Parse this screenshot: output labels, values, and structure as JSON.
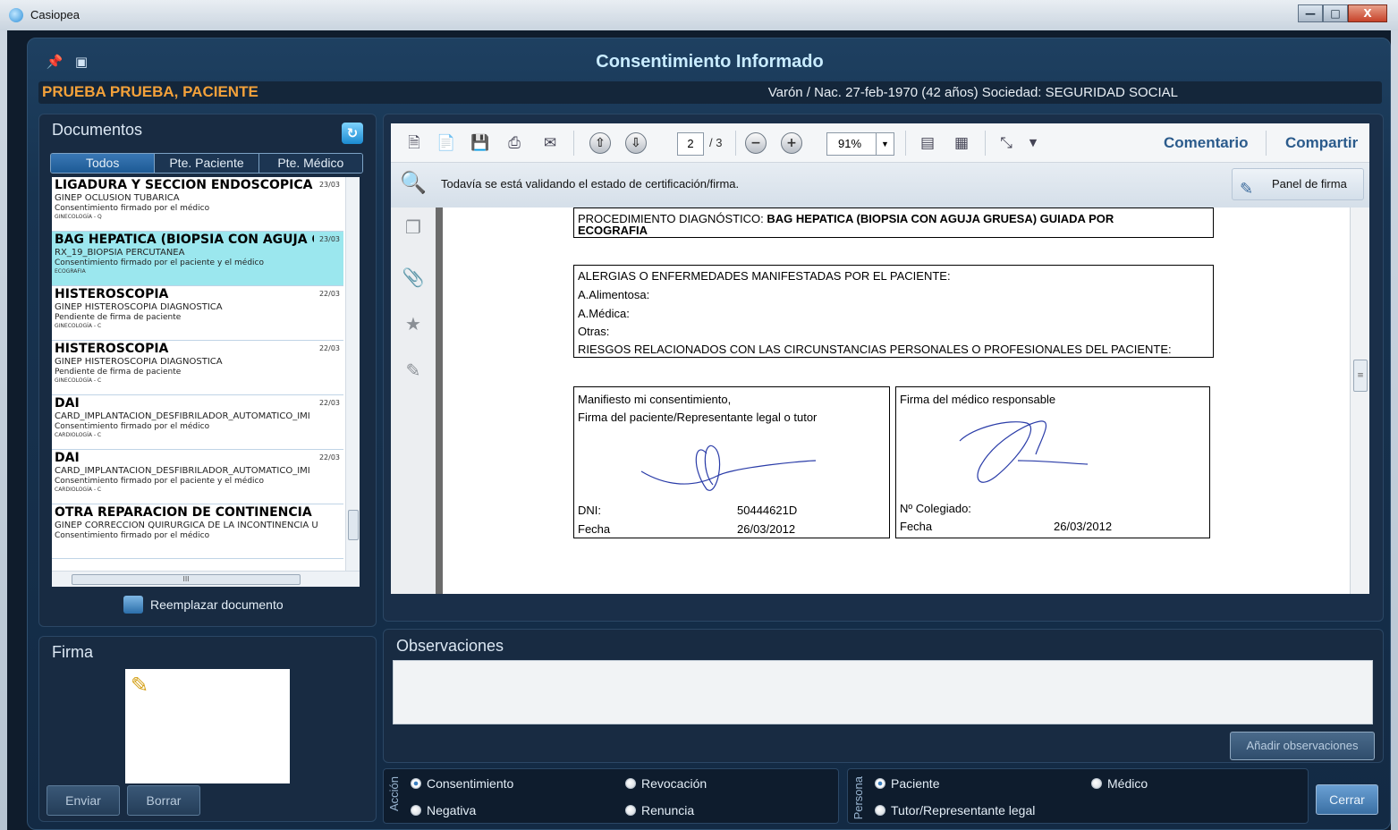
{
  "window": {
    "title": "Casiopea",
    "min": "—",
    "max": "□",
    "close": "X"
  },
  "header": {
    "title": "Consentimiento Informado",
    "patient_name": "PRUEBA PRUEBA, PACIENTE",
    "patient_info": "Varón / Nac. 27-feb-1970 (42 años) Sociedad: SEGURIDAD SOCIAL"
  },
  "docs": {
    "title": "Documentos",
    "tabs": [
      "Todos",
      "Pte. Paciente",
      "Pte. Médico"
    ],
    "items": [
      {
        "title": "LIGADURA Y SECCION ENDOSCOPICA BI...",
        "date": "23/03",
        "sub": "GINEP OCLUSIÓN TUBÁRICA",
        "status": "Consentimiento firmado por el médico",
        "dept": "GINECOLOGÍA - Q"
      },
      {
        "title": "BAG HEPATICA (BIOPSIA CON AGUJA G...",
        "date": "23/03",
        "sub": "RX_19_BIOPSIA PERCUTANEA",
        "status": "Consentimiento firmado por el paciente y el médico",
        "dept": "ECOGRAFIA"
      },
      {
        "title": "HISTEROSCOPIA",
        "date": "22/03",
        "sub": "GINEP HISTEROSCOPIA DIAGNÓSTICA",
        "status": "Pendiente de firma de paciente",
        "dept": "GINECOLOGÍA - C"
      },
      {
        "title": "HISTEROSCOPIA",
        "date": "22/03",
        "sub": "GINEP HISTEROSCOPIA DIAGNÓSTICA",
        "status": "Pendiente de firma de paciente",
        "dept": "GINECOLOGÍA - C"
      },
      {
        "title": "DAI",
        "date": "22/03",
        "sub": "CARD_IMPLANTACION_DESFIBRILADOR_AUTOMATICO_IMI",
        "status": "Consentimiento firmado por el médico",
        "dept": "CARDIOLOGÍA - C"
      },
      {
        "title": "DAI",
        "date": "22/03",
        "sub": "CARD_IMPLANTACION_DESFIBRILADOR_AUTOMATICO_IMI",
        "status": "Consentimiento firmado por el paciente y el médico",
        "dept": "CARDIOLOGÍA - C"
      },
      {
        "title": "OTRA REPARACION DE CONTINENCIA U...",
        "date": "",
        "sub": "GINEP CORRECCIÓN QUIRÚRGICA DE LA INCONTINENCIA U",
        "status": "Consentimiento firmado por el médico",
        "dept": ""
      }
    ],
    "replace_label": "Reemplazar documento"
  },
  "firma": {
    "title": "Firma",
    "send": "Enviar",
    "clear": "Borrar"
  },
  "viewer": {
    "page_current": "2",
    "page_total": "/ 3",
    "zoom": "91%",
    "comment": "Comentario",
    "share": "Compartir",
    "status_msg": "Todavía se está validando el estado de certificación/firma.",
    "sign_panel": "Panel de firma"
  },
  "pdf": {
    "proc_label": "PROCEDIMIENTO DIAGNÓSTICO: ",
    "proc_value": "BAG HEPATICA (BIOPSIA CON AGUJA GRUESA) GUIADA POR",
    "proc_value2": "ECOGRAFIA",
    "allergy_title": "ALERGIAS O ENFERMEDADES MANIFESTADAS POR EL PACIENTE:",
    "allergy_food": "A.Alimentosa:",
    "allergy_med": "A.Médica:",
    "allergy_other": "Otras:",
    "risks": "RIESGOS RELACIONADOS CON LAS CIRCUNSTANCIAS PERSONALES O PROFESIONALES DEL PACIENTE:",
    "patient_consent": "Manifiesto mi consentimiento,",
    "patient_sign": "Firma del paciente/Representante legal o tutor",
    "dni_label": "DNI:",
    "dni": "50444621D",
    "date_label": "Fecha",
    "date": "26/03/2012",
    "doctor_sign": "Firma del médico responsable",
    "colegiado_label": "Nº Colegiado:",
    "doctor_date": "26/03/2012"
  },
  "observaciones": {
    "title": "Observaciones",
    "add": "Añadir observaciones"
  },
  "accion": {
    "label": "Acción",
    "options": [
      "Consentimiento",
      "Revocación",
      "Negativa",
      "Renuncia"
    ],
    "selected": "Consentimiento"
  },
  "persona": {
    "label": "Persona",
    "options": [
      "Paciente",
      "Médico",
      "Tutor/Representante legal"
    ],
    "selected": "Paciente"
  },
  "close": "Cerrar"
}
